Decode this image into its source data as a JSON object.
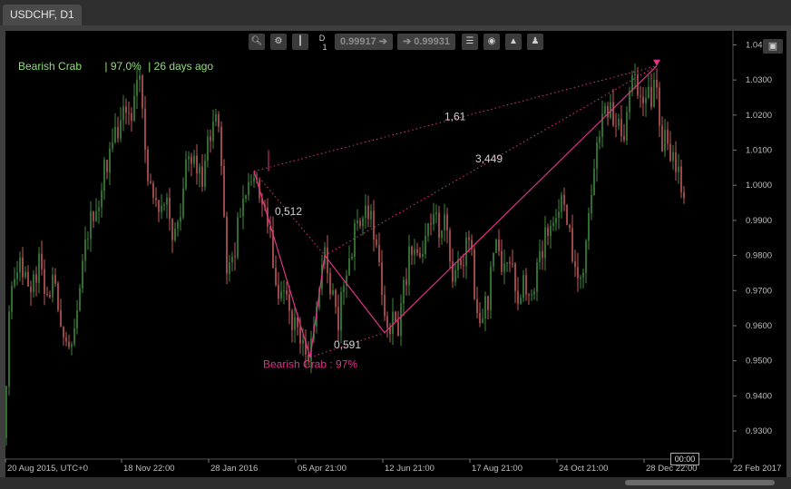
{
  "tab": {
    "label": "USDCHF, D1"
  },
  "toolbar": {
    "timeframe_d": "D",
    "timeframe_num": "1",
    "bid": "0.99917",
    "ask": "0.99931",
    "icons": [
      "zoom-icon",
      "settings-icon",
      "candles-icon",
      "timeframe-icon",
      "sell-arrow-icon",
      "buy-arrow-icon",
      "list-icon",
      "object-icon",
      "pattern-icon",
      "person-icon"
    ]
  },
  "header": {
    "pattern": "Bearish Crab",
    "probability": "| 97,0%",
    "age": "| 26 days ago"
  },
  "time_marker": "00:00",
  "chart_data": {
    "type": "candlestick",
    "symbol": "USDCHF",
    "timeframe": "D1",
    "ylim": [
      0.922,
      1.044
    ],
    "y_ticks": [
      {
        "v": 1.04,
        "l": "1.04"
      },
      {
        "v": 1.03,
        "l": "1.0300"
      },
      {
        "v": 1.02,
        "l": "1.0200"
      },
      {
        "v": 1.01,
        "l": "1.0100"
      },
      {
        "v": 1.0,
        "l": "1.0000"
      },
      {
        "v": 0.99,
        "l": "0.9900"
      },
      {
        "v": 0.98,
        "l": "0.9800"
      },
      {
        "v": 0.97,
        "l": "0.9700"
      },
      {
        "v": 0.96,
        "l": "0.9600"
      },
      {
        "v": 0.95,
        "l": "0.9500"
      },
      {
        "v": 0.94,
        "l": "0.9400"
      },
      {
        "v": 0.93,
        "l": "0.9300"
      }
    ],
    "x_ticks": [
      "20 Aug 2015, UTC+0",
      "18 Nov 22:00",
      "28 Jan 2016",
      "05 Apr 21:00",
      "12 Jun 21:00",
      "17 Aug 21:00",
      "24 Oct 21:00",
      "28 Dec 22:00",
      "22 Feb 2017"
    ],
    "price_path": [
      [
        0,
        0.928
      ],
      [
        3,
        0.962
      ],
      [
        7,
        0.974
      ],
      [
        11,
        0.968
      ],
      [
        16,
        0.976
      ],
      [
        20,
        0.975
      ],
      [
        26,
        0.972
      ],
      [
        32,
        0.973
      ],
      [
        38,
        0.978
      ],
      [
        44,
        0.97
      ],
      [
        52,
        0.972
      ],
      [
        58,
        0.966
      ],
      [
        64,
        0.96
      ],
      [
        70,
        0.955
      ],
      [
        76,
        0.962
      ],
      [
        82,
        0.974
      ],
      [
        88,
        0.985
      ],
      [
        96,
        0.992
      ],
      [
        104,
        0.997
      ],
      [
        110,
        1.005
      ],
      [
        116,
        1.012
      ],
      [
        122,
        1.015
      ],
      [
        128,
        1.022
      ],
      [
        134,
        1.025
      ],
      [
        140,
        1.02
      ],
      [
        146,
        1.03
      ],
      [
        150,
        1.031
      ],
      [
        154,
        1.01
      ],
      [
        158,
        0.998
      ],
      [
        164,
        0.996
      ],
      [
        170,
        0.99
      ],
      [
        176,
        0.994
      ],
      [
        182,
        0.99
      ],
      [
        188,
        0.985
      ],
      [
        194,
        0.996
      ],
      [
        200,
        1.01
      ],
      [
        206,
        1.004
      ],
      [
        212,
        1.006
      ],
      [
        218,
        1.002
      ],
      [
        224,
        1.014
      ],
      [
        230,
        1.02
      ],
      [
        236,
        1.015
      ],
      [
        240,
        0.994
      ],
      [
        244,
        0.976
      ],
      [
        248,
        0.974
      ],
      [
        254,
        0.985
      ],
      [
        260,
        0.994
      ],
      [
        266,
        0.998
      ],
      [
        272,
        1.004
      ],
      [
        278,
        0.998
      ],
      [
        284,
        0.996
      ],
      [
        290,
        0.988
      ],
      [
        296,
        0.976
      ],
      [
        302,
        0.968
      ],
      [
        308,
        0.972
      ],
      [
        314,
        0.964
      ],
      [
        320,
        0.958
      ],
      [
        326,
        0.956
      ],
      [
        332,
        0.952
      ],
      [
        336,
        0.951
      ],
      [
        342,
        0.96
      ],
      [
        348,
        0.975
      ],
      [
        352,
        0.98
      ],
      [
        356,
        0.974
      ],
      [
        362,
        0.966
      ],
      [
        366,
        0.96
      ],
      [
        370,
        0.966
      ],
      [
        374,
        0.972
      ],
      [
        378,
        0.978
      ],
      [
        384,
        0.986
      ],
      [
        390,
        0.99
      ],
      [
        396,
        0.994
      ],
      [
        402,
        0.993
      ],
      [
        408,
        0.986
      ],
      [
        412,
        0.976
      ],
      [
        416,
        0.965
      ],
      [
        420,
        0.96
      ],
      [
        426,
        0.962
      ],
      [
        432,
        0.957
      ],
      [
        438,
        0.97
      ],
      [
        444,
        0.978
      ],
      [
        450,
        0.982
      ],
      [
        456,
        0.978
      ],
      [
        462,
        0.984
      ],
      [
        468,
        0.987
      ],
      [
        474,
        0.99
      ],
      [
        478,
        0.987
      ],
      [
        482,
        0.984
      ],
      [
        486,
        0.993
      ],
      [
        490,
        0.976
      ],
      [
        494,
        0.97
      ],
      [
        500,
        0.976
      ],
      [
        506,
        0.98
      ],
      [
        512,
        0.984
      ],
      [
        518,
        0.968
      ],
      [
        522,
        0.96
      ],
      [
        528,
        0.964
      ],
      [
        534,
        0.97
      ],
      [
        540,
        0.988
      ],
      [
        546,
        0.976
      ],
      [
        552,
        0.978
      ],
      [
        558,
        0.976
      ],
      [
        564,
        0.968
      ],
      [
        570,
        0.972
      ],
      [
        576,
        0.966
      ],
      [
        582,
        0.972
      ],
      [
        588,
        0.976
      ],
      [
        594,
        0.984
      ],
      [
        600,
        0.988
      ],
      [
        606,
        0.992
      ],
      [
        612,
        0.996
      ],
      [
        618,
        0.994
      ],
      [
        622,
        0.988
      ],
      [
        628,
        0.974
      ],
      [
        632,
        0.97
      ],
      [
        636,
        0.976
      ],
      [
        640,
        0.986
      ],
      [
        644,
        0.995
      ],
      [
        648,
        1.002
      ],
      [
        652,
        1.01
      ],
      [
        656,
        1.013
      ],
      [
        660,
        1.022
      ],
      [
        664,
        1.018
      ],
      [
        668,
        1.022
      ],
      [
        672,
        1.016
      ],
      [
        676,
        1.02
      ],
      [
        680,
        1.012
      ],
      [
        684,
        1.018
      ],
      [
        688,
        1.028
      ],
      [
        692,
        1.032
      ],
      [
        696,
        1.026
      ],
      [
        700,
        1.022
      ],
      [
        704,
        1.026
      ],
      [
        708,
        1.03
      ],
      [
        712,
        1.024
      ],
      [
        716,
        1.032
      ],
      [
        720,
        1.018
      ],
      [
        724,
        1.012
      ],
      [
        728,
        1.016
      ],
      [
        732,
        1.01
      ],
      [
        736,
        1.006
      ],
      [
        740,
        1.008
      ],
      [
        744,
        1.0
      ],
      [
        748,
        0.998
      ],
      [
        752,
        1.0
      ]
    ],
    "pattern": {
      "name": "Bearish Crab",
      "points": [
        {
          "x": 274,
          "y": 1.004
        },
        {
          "x": 336,
          "y": 0.951
        },
        {
          "x": 352,
          "y": 0.98
        },
        {
          "x": 418,
          "y": 0.958
        },
        {
          "x": 718,
          "y": 1.034
        }
      ],
      "ratios": [
        {
          "label": "0,512",
          "x": 297,
          "y": 0.9915
        },
        {
          "label": "0,591",
          "x": 362,
          "y": 0.9535
        },
        {
          "label": "1,61",
          "x": 484,
          "y": 1.0185
        },
        {
          "label": "3,449",
          "x": 518,
          "y": 1.0065
        }
      ],
      "label": "Bearish Crab : 97%",
      "label_x": 284,
      "label_y": 0.948
    }
  }
}
